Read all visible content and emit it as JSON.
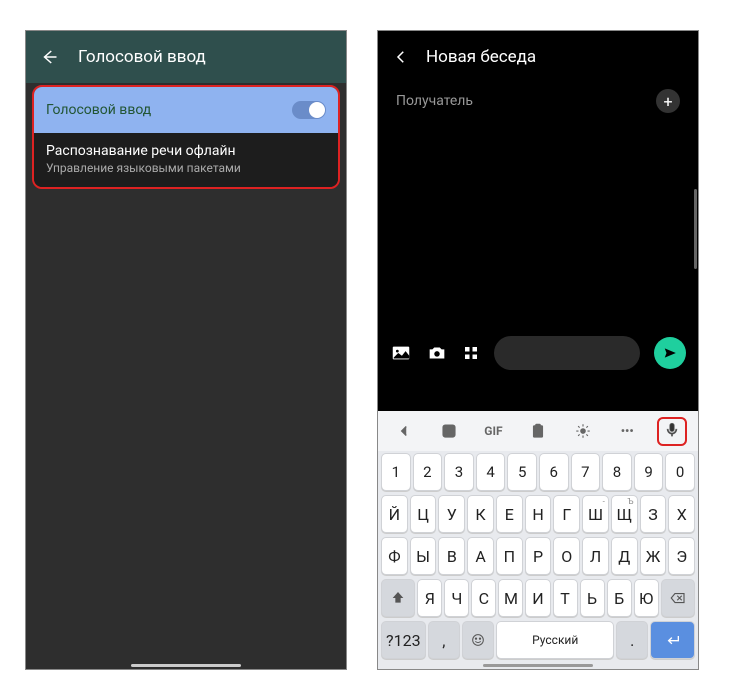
{
  "left": {
    "title": "Голосовой ввод",
    "voice_input_label": "Голосовой ввод",
    "offline_title": "Распознавание речи офлайн",
    "offline_sub": "Управление языковыми пакетами"
  },
  "right": {
    "title": "Новая беседа",
    "recipient_placeholder": "Получатель"
  },
  "kb": {
    "gif": "GIF",
    "dots": "•••",
    "numrow": [
      "1",
      "2",
      "3",
      "4",
      "5",
      "6",
      "7",
      "8",
      "9",
      "0"
    ],
    "row1": [
      "Й",
      "Ц",
      "У",
      "К",
      "Е",
      "Н",
      "Г",
      "Ш",
      "Щ",
      "З",
      "Х"
    ],
    "row1sup": [
      "",
      "",
      "",
      "",
      "",
      "",
      "",
      "-",
      "Ъ",
      "",
      ""
    ],
    "row2": [
      "Ф",
      "Ы",
      "В",
      "А",
      "П",
      "Р",
      "О",
      "Л",
      "Д",
      "Ж",
      "Э"
    ],
    "row3": [
      "Я",
      "Ч",
      "С",
      "М",
      "И",
      "Т",
      "Ь",
      "Б",
      "Ю"
    ],
    "mode": "?123",
    "lang": "Русский"
  }
}
